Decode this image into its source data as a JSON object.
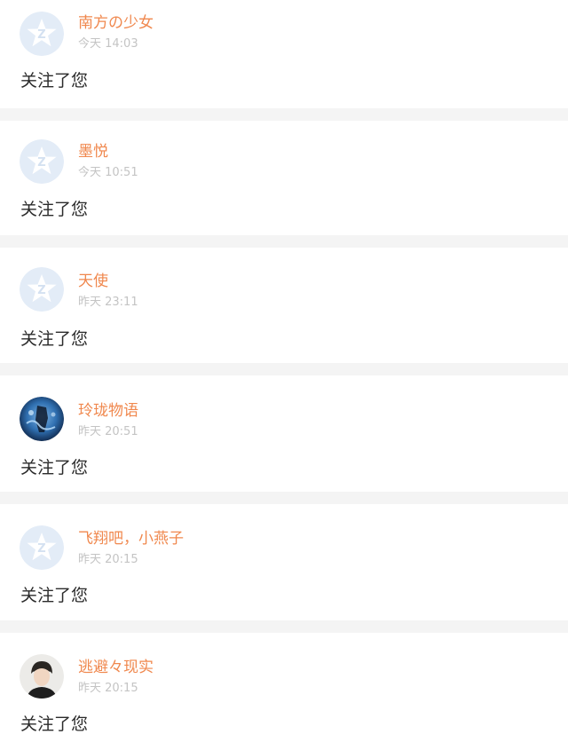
{
  "notifications": [
    {
      "username": "南方の少女",
      "time": "今天 14:03",
      "message": "关注了您",
      "avatar": "default-qzone-avatar"
    },
    {
      "username": "墨悦",
      "time": "今天 10:51",
      "message": "关注了您",
      "avatar": "default-qzone-avatar"
    },
    {
      "username": "天使",
      "time": "昨天 23:11",
      "message": "关注了您",
      "avatar": "default-qzone-avatar"
    },
    {
      "username": "玲珑物语",
      "time": "昨天 20:51",
      "message": "关注了您",
      "avatar": "photo-avatar-blue-figure"
    },
    {
      "username": "飞翔吧，小燕子",
      "time": "昨天 20:15",
      "message": "关注了您",
      "avatar": "default-qzone-avatar"
    },
    {
      "username": "逃避々现实",
      "time": "昨天 20:15",
      "message": "关注了您",
      "avatar": "photo-avatar-boy"
    }
  ],
  "colors": {
    "username": "#f0884e",
    "time": "#c4c4c4",
    "message": "#2b2b2b",
    "separator": "#f4f4f4",
    "default_avatar_bg": "#e3ecf7"
  }
}
